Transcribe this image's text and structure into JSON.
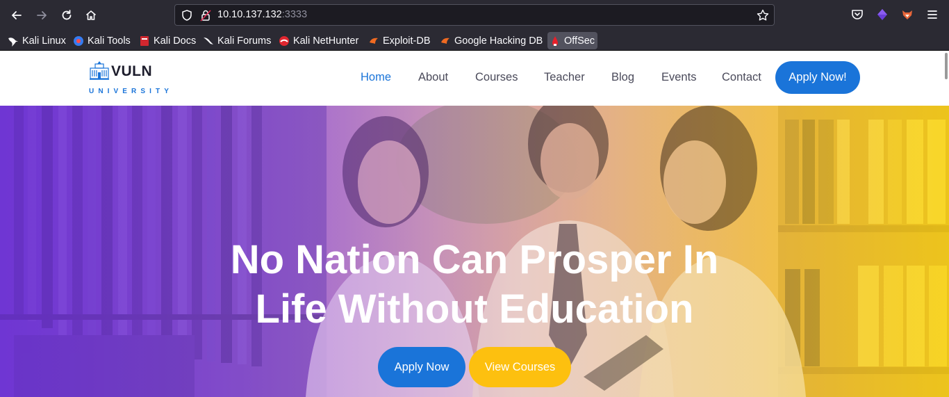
{
  "browser": {
    "url_host": "10.10.137.132",
    "url_port": ":3333",
    "bookmarks": [
      {
        "label": "Kali Linux",
        "icon": "kali-dragon-icon"
      },
      {
        "label": "Kali Tools",
        "icon": "kali-tools-icon"
      },
      {
        "label": "Kali Docs",
        "icon": "kali-docs-icon"
      },
      {
        "label": "Kali Forums",
        "icon": "kali-forums-icon"
      },
      {
        "label": "Kali NetHunter",
        "icon": "nethunter-icon"
      },
      {
        "label": "Exploit-DB",
        "icon": "exploit-db-icon"
      },
      {
        "label": "Google Hacking DB",
        "icon": "ghdb-icon"
      },
      {
        "label": "OffSec",
        "icon": "offsec-icon"
      }
    ]
  },
  "site": {
    "logo_title": "VULN",
    "logo_subtitle": "UNIVERSITY",
    "nav": [
      "Home",
      "About",
      "Courses",
      "Teacher",
      "Blog",
      "Events",
      "Contact"
    ],
    "nav_active": "Home",
    "apply_now_nav": "Apply Now!",
    "accent_color": "#1a74d9",
    "secondary_color": "#fdc00f"
  },
  "hero": {
    "title_line1": "No Nation Can Prosper In",
    "title_line2": "Life Without Education",
    "apply_button": "Apply Now",
    "courses_button": "View Courses"
  }
}
